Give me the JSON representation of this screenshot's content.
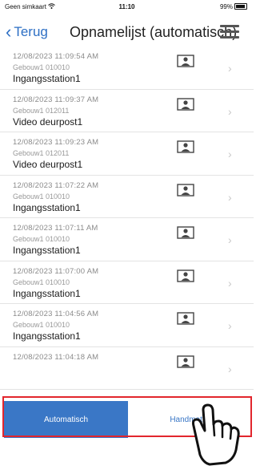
{
  "status": {
    "carrier": "Geen simkaart",
    "time": "11:10",
    "battery": "99%"
  },
  "nav": {
    "back_label": "Terug",
    "title": "Opnamelijst (automatisch)"
  },
  "recordings": [
    {
      "timestamp": "12/08/2023 11:09:54 AM",
      "building": "Gebouw1 010010",
      "name": "Ingangsstation1"
    },
    {
      "timestamp": "12/08/2023 11:09:37 AM",
      "building": "Gebouw1 012011",
      "name": "Video deurpost1"
    },
    {
      "timestamp": "12/08/2023 11:09:23 AM",
      "building": "Gebouw1 012011",
      "name": "Video deurpost1"
    },
    {
      "timestamp": "12/08/2023 11:07:22 AM",
      "building": "Gebouw1 010010",
      "name": "Ingangsstation1"
    },
    {
      "timestamp": "12/08/2023 11:07:11 AM",
      "building": "Gebouw1 010010",
      "name": "Ingangsstation1"
    },
    {
      "timestamp": "12/08/2023 11:07:00 AM",
      "building": "Gebouw1 010010",
      "name": "Ingangsstation1"
    },
    {
      "timestamp": "12/08/2023 11:04:56 AM",
      "building": "Gebouw1 010010",
      "name": "Ingangsstation1"
    },
    {
      "timestamp": "12/08/2023 11:04:18 AM",
      "building": "",
      "name": ""
    }
  ],
  "tabs": {
    "automatic": "Automatisch",
    "manual": "Handmatig"
  },
  "colors": {
    "accent": "#3a77c6",
    "highlight": "#e2262d"
  }
}
